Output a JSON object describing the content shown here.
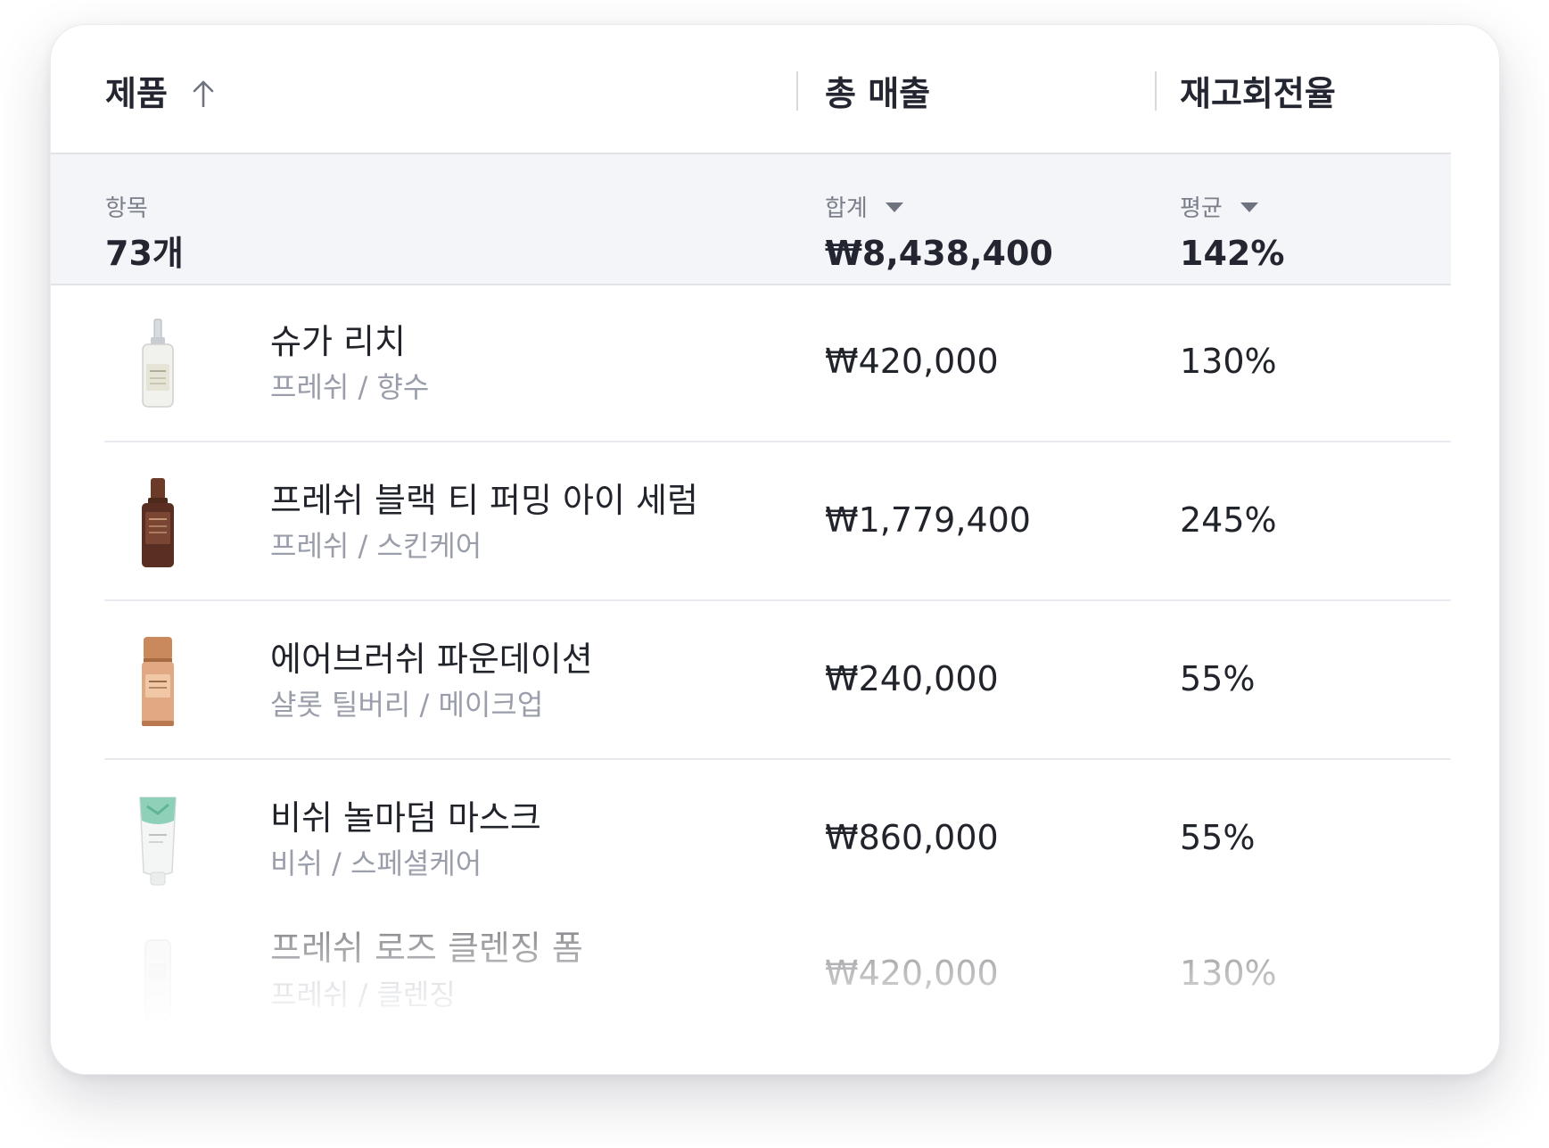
{
  "header": {
    "product_label": "제품",
    "sales_label": "총 매출",
    "turnover_label": "재고회전율"
  },
  "summary": {
    "items_label": "항목",
    "items_value": "73개",
    "sales_agg_label": "합계",
    "sales_value": "₩8,438,400",
    "turnover_agg_label": "평균",
    "turnover_value": "142%"
  },
  "rows": [
    {
      "name": "슈가 리치",
      "sub": "프레쉬 / 향수",
      "sales": "₩420,000",
      "turnover": "130%",
      "icon": "perfume-bottle-icon"
    },
    {
      "name": "프레쉬 블랙 티 퍼밍 아이 세럼",
      "sub": "프레쉬 / 스킨케어",
      "sales": "₩1,779,400",
      "turnover": "245%",
      "icon": "serum-bottle-icon"
    },
    {
      "name": "에어브러쉬 파운데이션",
      "sub": "샬롯 틸버리 / 메이크업",
      "sales": "₩240,000",
      "turnover": "55%",
      "icon": "foundation-bottle-icon"
    },
    {
      "name": "비쉬 놀마덤 마스크",
      "sub": "비쉬 / 스페셜케어",
      "sales": "₩860,000",
      "turnover": "55%",
      "icon": "mask-tube-icon"
    },
    {
      "name": "프레쉬 로즈 클렌징 폼",
      "sub": "프레쉬 / 클렌징",
      "sales": "₩420,000",
      "turnover": "130%",
      "icon": "cleanser-bottle-icon"
    }
  ],
  "colors": {
    "summary_bg": "#f3f5f9",
    "text_primary": "#22242c",
    "text_secondary": "#9a9eaa"
  }
}
